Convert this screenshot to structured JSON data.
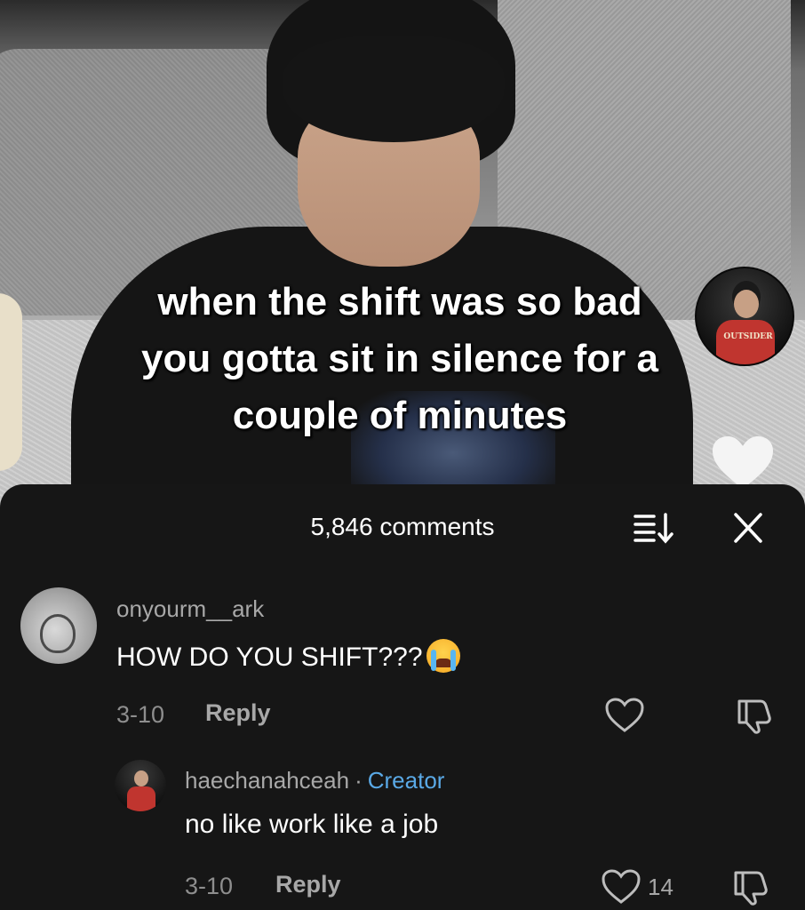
{
  "video": {
    "caption_line1": "when the shift was so bad",
    "caption_line2": "you gotta sit in silence for a",
    "caption_line3": "couple of minutes",
    "creator_avatar_shirt_text": "OUTSIDER"
  },
  "comments_sheet": {
    "title": "5,846 comments",
    "sort_icon": "sort-icon",
    "close_icon": "close-icon",
    "comments": [
      {
        "username": "onyourm__ark",
        "text": "HOW DO YOU SHIFT???",
        "emoji": "loudly-crying-face",
        "date": "3-10",
        "reply_label": "Reply",
        "likes": ""
      },
      {
        "username": "haechanahceah",
        "separator": "·",
        "badge": "Creator",
        "text": "no like work like a job",
        "date": "3-10",
        "reply_label": "Reply",
        "likes": "14"
      }
    ]
  },
  "colors": {
    "sheet_background": "#161616",
    "creator_badge": "#5aa9e6",
    "secondary_text": "#a8a8a8"
  }
}
